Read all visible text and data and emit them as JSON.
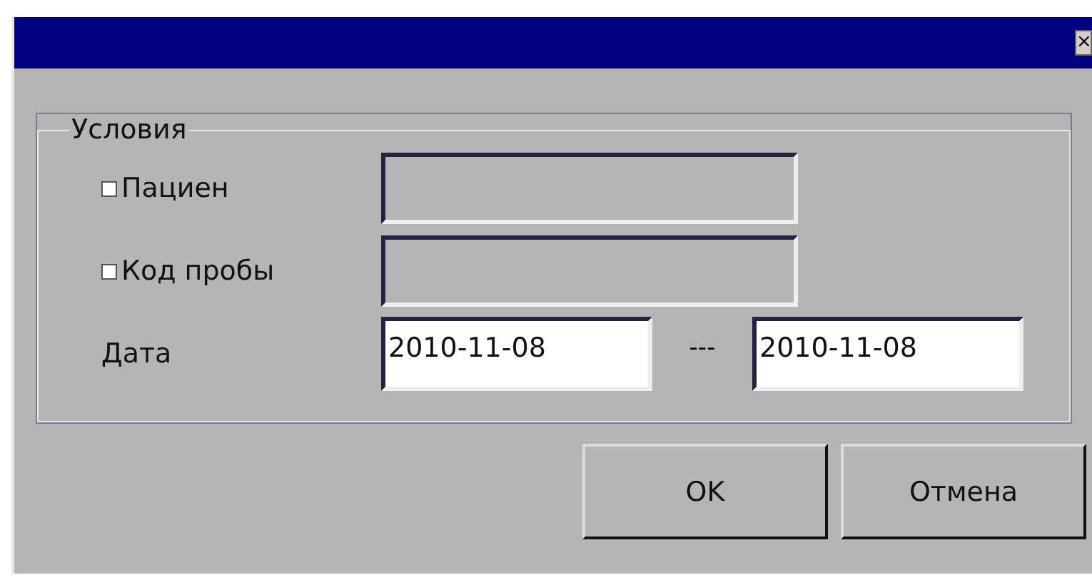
{
  "window": {
    "close_label": "×"
  },
  "group": {
    "title": "Условия",
    "rows": [
      {
        "kind": "check",
        "label": "Пациен",
        "checked": false
      },
      {
        "kind": "check",
        "label": "Код пробы",
        "checked": false
      },
      {
        "kind": "range",
        "label": "Дата",
        "from": "2010-11-08",
        "separator": "---",
        "to": "2010-11-08"
      }
    ]
  },
  "buttons": [
    "OK",
    "Отмена"
  ]
}
